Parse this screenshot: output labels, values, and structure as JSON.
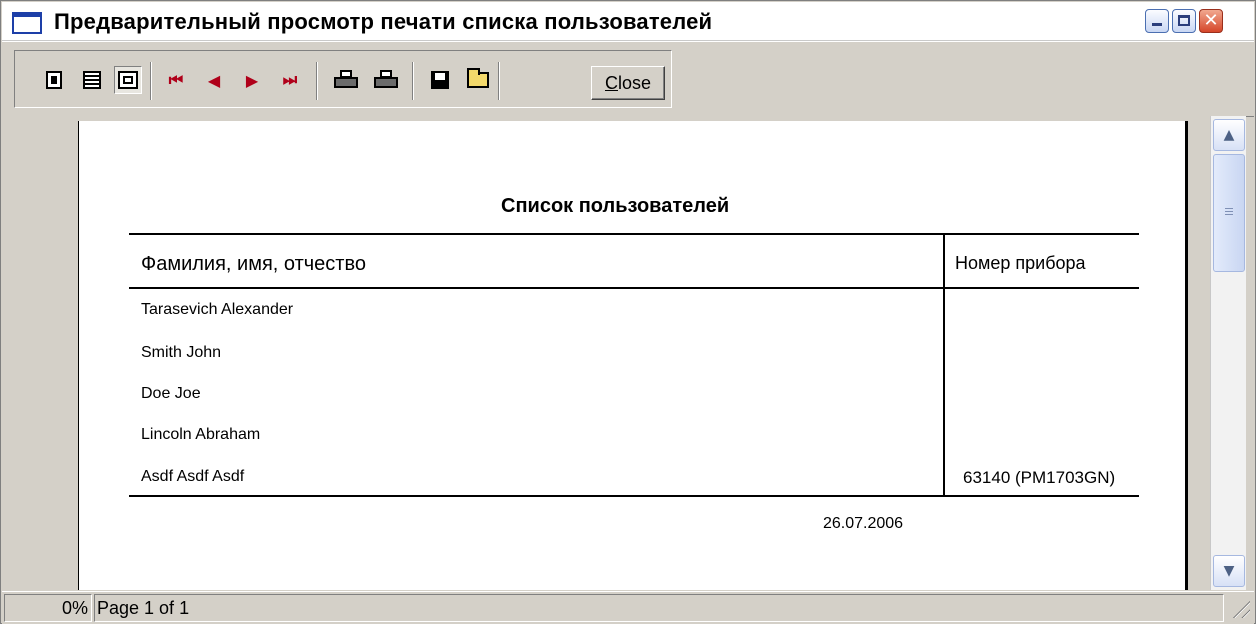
{
  "window": {
    "title": "Предварительный просмотр печати списка пользователей"
  },
  "toolbar": {
    "close_label": "Close",
    "buttons": [
      "one-page-icon",
      "multi-page-icon",
      "zoom-page-icon",
      "first-page-icon",
      "prev-page-icon",
      "next-page-icon",
      "last-page-icon",
      "print-setup-icon",
      "print-icon",
      "save-icon",
      "open-icon"
    ]
  },
  "report": {
    "title": "Список пользователей",
    "columns": {
      "name": "Фамилия, имя, отчество",
      "device": "Номер прибора"
    },
    "rows": [
      {
        "name": "Tarasevich Alexander",
        "device": ""
      },
      {
        "name": "Smith John",
        "device": ""
      },
      {
        "name": "Doe Joe",
        "device": ""
      },
      {
        "name": "Lincoln Abraham",
        "device": ""
      },
      {
        "name": "Asdf Asdf Asdf",
        "device": "63140 (PM1703GN)"
      }
    ],
    "date": "26.07.2006"
  },
  "status": {
    "progress": "0%",
    "page": "Page 1 of 1"
  }
}
